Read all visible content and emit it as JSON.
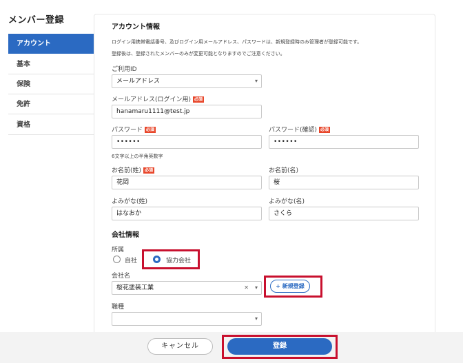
{
  "sidebar": {
    "title": "メンバー登録",
    "items": [
      {
        "label": "アカウント",
        "active": true
      },
      {
        "label": "基本"
      },
      {
        "label": "保険"
      },
      {
        "label": "免許"
      },
      {
        "label": "資格"
      }
    ]
  },
  "account": {
    "heading": "アカウント情報",
    "desc1": "ログイン用携帯電話番号、及びログイン用メールアドレス、パスワードは、新規登録時のみ管理者が登録可能です。",
    "desc2": "登録後は、登録されたメンバーのみが変更可能となりますのでご注意ください。",
    "usage_id_label": "ご利用ID",
    "usage_id_value": "メールアドレス",
    "email_label": "メールアドレス(ログイン用)",
    "email_value": "hanamaru1111@test.jp",
    "password_label": "パスワード",
    "password_value": "••••••",
    "password_confirm_label": "パスワード(確認)",
    "password_confirm_value": "••••••",
    "password_hint": "6文字以上の半角英数字",
    "last_name_label": "お名前(姓)",
    "last_name_value": "花岡",
    "first_name_label": "お名前(名)",
    "first_name_value": "桜",
    "last_kana_label": "よみがな(姓)",
    "last_kana_value": "はなおか",
    "first_kana_label": "よみがな(名)",
    "first_kana_value": "さくら",
    "required_badge": "必須"
  },
  "company": {
    "heading": "会社情報",
    "affiliation_label": "所属",
    "option_own": "自社",
    "option_partner": "協力会社",
    "selected": "協力会社",
    "company_name_label": "会社名",
    "company_name_value": "桜花塗装工業",
    "new_register_label": "+ 新規登録",
    "job_type_label": "職種",
    "job_type_value": ""
  },
  "footer": {
    "cancel_label": "キャンセル",
    "submit_label": "登録"
  },
  "colors": {
    "accent": "#2b6ac2",
    "required": "#e8462a",
    "highlight": "#c8102e"
  }
}
